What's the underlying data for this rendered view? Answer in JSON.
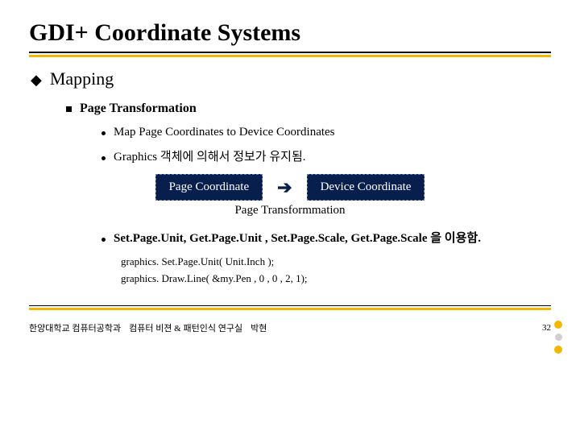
{
  "title": "GDI+ Coordinate Systems",
  "lvl1": {
    "bullet": "◆",
    "text": "Mapping"
  },
  "lvl2": {
    "text": "Page Transformation"
  },
  "items": [
    "Map Page Coordinates to Device Coordinates",
    "Graphics 객체에 의해서 정보가 유지됨."
  ],
  "boxes": {
    "left": "Page Coordinate",
    "right": "Device Coordinate",
    "arrow": "➔"
  },
  "caption": "Page Transformmation",
  "api_line": "Set.Page.Unit, Get.Page.Unit , Set.Page.Scale, Get.Page.Scale 을 이용함.",
  "code": [
    "graphics. Set.Page.Unit( Unit.Inch );",
    "graphics. Draw.Line( &my.Pen , 0 , 0 , 2, 1);"
  ],
  "footer": {
    "org1": "한양대학교 컴퓨터공학과",
    "org2": "컴퓨터 비젼 & 패턴인식 연구실",
    "author": "박현",
    "page": "32"
  }
}
